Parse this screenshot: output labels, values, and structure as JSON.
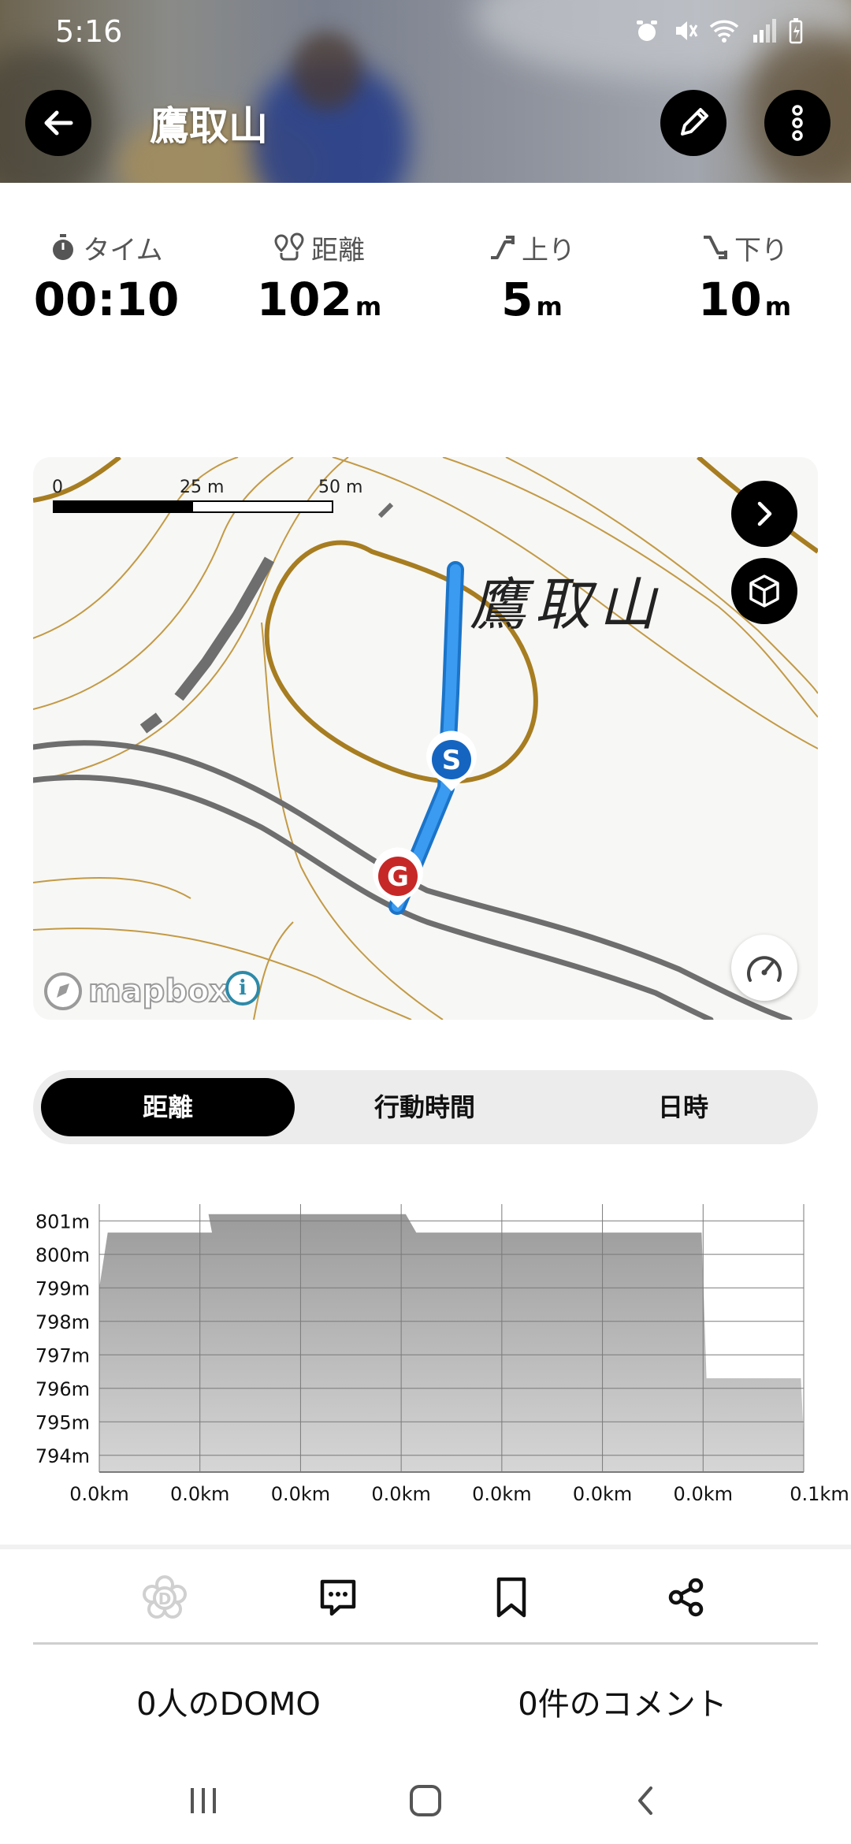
{
  "status_bar": {
    "time": "5:16"
  },
  "header": {
    "title": "鷹取山"
  },
  "stats": [
    {
      "label": "タイム",
      "value": "00:10",
      "unit": ""
    },
    {
      "label": "距離",
      "value": "102",
      "unit": "m"
    },
    {
      "label": "上り",
      "value": "5",
      "unit": "m"
    },
    {
      "label": "下り",
      "value": "10",
      "unit": "m"
    }
  ],
  "map": {
    "place_label": "鷹取山",
    "scale": {
      "zero": "0",
      "mid": "25 m",
      "max": "50 m"
    },
    "start_marker": "S",
    "goal_marker": "G",
    "attribution": "mapbox",
    "colors": {
      "route": "#2f8fe6",
      "start": "#1565c0",
      "goal": "#c62828",
      "contour": "#b88c2e",
      "road": "#6e6e6e"
    }
  },
  "segments": {
    "items": [
      "距離",
      "行動時間",
      "日時"
    ],
    "active_index": 0
  },
  "chart_data": {
    "type": "area",
    "title": "",
    "xlabel": "",
    "ylabel": "",
    "x_tick_labels": [
      "0.0km",
      "0.0km",
      "0.0km",
      "0.0km",
      "0.0km",
      "0.0km",
      "0.0km",
      "0.1km"
    ],
    "y_tick_labels": [
      "801m",
      "800m",
      "799m",
      "798m",
      "797m",
      "796m",
      "795m",
      "794m"
    ],
    "ylim": [
      793.5,
      801.5
    ],
    "xlim": [
      0,
      0.1
    ],
    "grid": true,
    "x": [
      0,
      0.0012,
      0.0146,
      0.016,
      0.0155,
      0.0435,
      0.045,
      0.0575,
      0.0585,
      0.0655,
      0.0855,
      0.0862,
      0.0868,
      0.0996,
      0.1
    ],
    "values": [
      799.0,
      800.65,
      800.65,
      800.65,
      801.2,
      801.2,
      800.65,
      800.65,
      800.65,
      800.65,
      800.65,
      796.3,
      796.3,
      796.3,
      794.5
    ]
  },
  "actions": {
    "domo_count": "0人のDOMO",
    "comment_count": "0件のコメント"
  }
}
